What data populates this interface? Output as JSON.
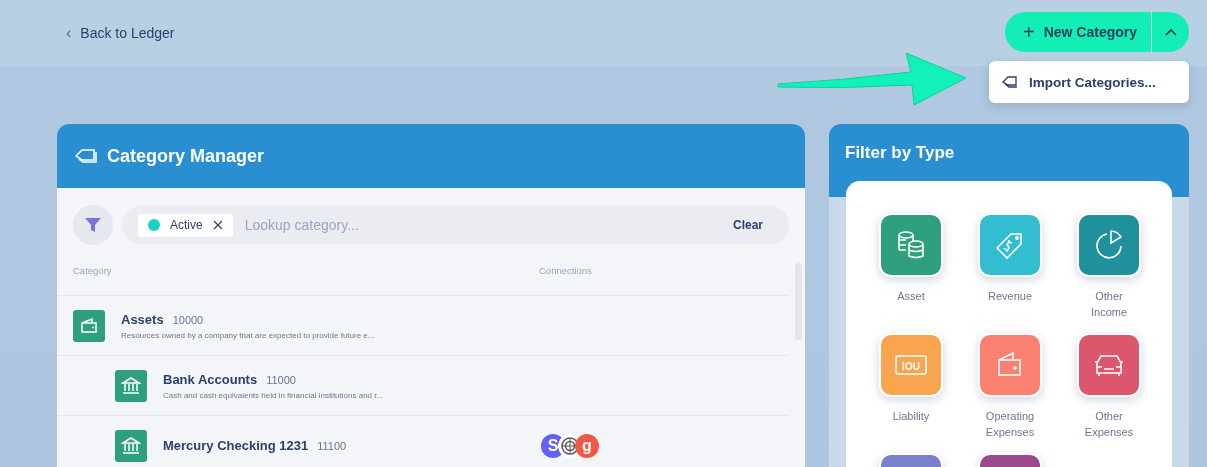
{
  "back_link": {
    "label": "Back to Ledger",
    "icon": "‹"
  },
  "new_button": {
    "icon": "+",
    "label": "New Category",
    "menu_open": true
  },
  "dropdown": {
    "items": [
      {
        "label": "Import Categories..."
      }
    ]
  },
  "annotation": {
    "kind": "arrow"
  },
  "manager": {
    "title": "Category Manager",
    "filter_chip": {
      "label": "Active",
      "color": "#17d4c0"
    },
    "search": {
      "placeholder": "Lookup category..."
    },
    "clear_label": "Clear",
    "columns": [
      "Category",
      "Connections"
    ],
    "rows": [
      {
        "kind": "wallet",
        "name": "Assets",
        "code": "10000",
        "description": "Resources owned by a company that are expected to provide future e...",
        "children": [
          {
            "kind": "bank",
            "name": "Bank Accounts",
            "code": "11000",
            "description": "Cash and cash equivalents held in financial institutions and r..."
          },
          {
            "kind": "bank",
            "name": "Mercury Checking 1231",
            "code": "11100",
            "connections": [
              {
                "kind": "letter",
                "label": "S",
                "color": "#6360f6"
              },
              {
                "kind": "emblem"
              },
              {
                "kind": "letter",
                "label": "g",
                "color": "#f05a44"
              }
            ]
          }
        ]
      }
    ]
  },
  "type_filter": {
    "title": "Filter by Type",
    "types": [
      {
        "kind": "coins",
        "label": "Asset",
        "color": "#2fa07e"
      },
      {
        "kind": "tag",
        "label": "Revenue",
        "color": "#33bdd1"
      },
      {
        "kind": "pie",
        "label": "Other Income",
        "color": "#20909d"
      },
      {
        "kind": "iou",
        "label": "Liability",
        "color": "#f9a54f",
        "badge": "IOU"
      },
      {
        "kind": "wallet",
        "label": "Operating Expenses",
        "color": "#fa8071"
      },
      {
        "kind": "car",
        "label": "Other Expenses",
        "color": "#dc566d"
      },
      {
        "kind": "blank",
        "color": "#7a80cc"
      },
      {
        "kind": "blank",
        "color": "#9b4a8e"
      }
    ]
  }
}
